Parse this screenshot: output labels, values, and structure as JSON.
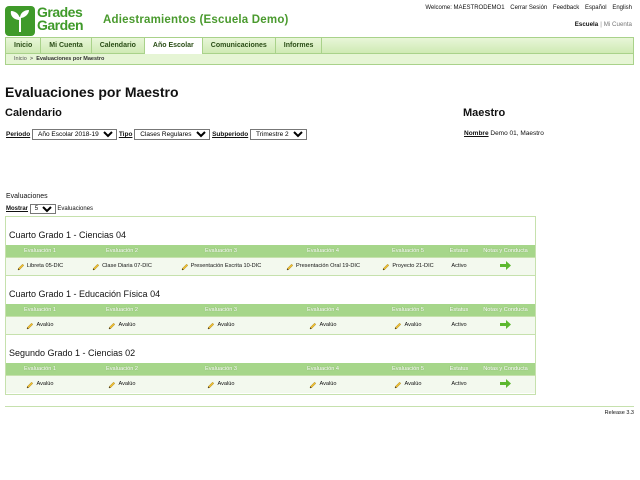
{
  "brand": {
    "logo_line1": "Grades",
    "logo_line2": "Garden"
  },
  "app_title": "Adiestramientos (Escuela Demo)",
  "top_links": {
    "welcome": "Welcome: MAESTRODEMO1",
    "logout": "Cerrar Sesión",
    "feedback": "Feedback",
    "spanish": "Español",
    "english": "English"
  },
  "school_links": {
    "school": "Escuela",
    "separator": "|",
    "account": "Mi Cuenta"
  },
  "nav": {
    "tabs": [
      {
        "label": "Inicio",
        "active": false
      },
      {
        "label": "Mi Cuenta",
        "active": false
      },
      {
        "label": "Calendario",
        "active": false
      },
      {
        "label": "Año Escolar",
        "active": true
      },
      {
        "label": "Comunicaciones",
        "active": false
      },
      {
        "label": "Informes",
        "active": false
      }
    ]
  },
  "breadcrumb": {
    "home": "Inicio",
    "separator": ">",
    "current": "Evaluaciones por Maestro"
  },
  "page_title": "Evaluaciones por Maestro",
  "calendar": {
    "heading": "Calendario",
    "periodo_label": "Periodo",
    "periodo_value": "Año Escolar 2018-19",
    "tipo_label": "Tipo",
    "tipo_value": "Clases Regulares",
    "subperiodo_label": "Subperiodo",
    "subperiodo_value": "Trimestre 2"
  },
  "maestro": {
    "heading": "Maestro",
    "nombre_label": "Nombre",
    "nombre_value": "Demo 01, Maestro"
  },
  "evaluaciones": {
    "label": "Evaluaciones",
    "mostrar_label": "Mostrar",
    "mostrar_value": "5",
    "mostrar_suffix": "Evaluaciones",
    "columns": [
      "Evaluación 1",
      "Evaluación 2",
      "Evaluación 3",
      "Evaluación 4",
      "Evaluación 5",
      "Estatus",
      "Notas y Conducta"
    ],
    "groups": [
      {
        "title": "Cuarto Grado 1 - Ciencias 04",
        "evals": [
          "Libreta 05-DIC",
          "Clase Diaria 07-DIC",
          "Presentación Escrita 10-DIC",
          "Presentación Oral 19-DIC",
          "Proyecto 21-DIC"
        ],
        "status": "Activo"
      },
      {
        "title": "Cuarto Grado 1 - Educación Física 04",
        "evals": [
          "Avalúo",
          "Avalúo",
          "Avalúo",
          "Avalúo",
          "Avalúo"
        ],
        "status": "Activo"
      },
      {
        "title": "Segundo Grado 1 - Ciencias 02",
        "evals": [
          "Avalúo",
          "Avalúo",
          "Avalúo",
          "Avalúo",
          "Avalúo"
        ],
        "status": "Activo"
      }
    ]
  },
  "release": "Release 3.3",
  "colors": {
    "brand_green": "#3f9a2a",
    "header_green": "#a6d68a",
    "nav_bg": "#cfeab4",
    "arrow_green": "#5cb82e"
  },
  "icons": {
    "edit": "pencil-icon",
    "go": "arrow-right-icon"
  }
}
